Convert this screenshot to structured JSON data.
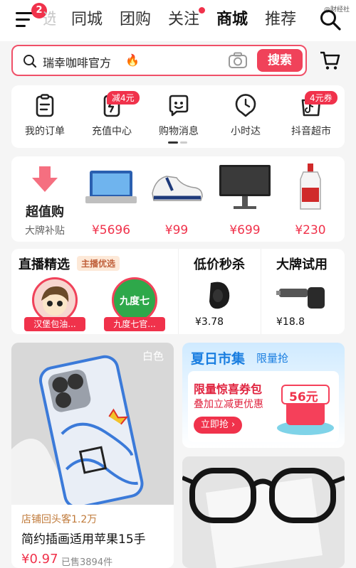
{
  "header": {
    "notification_count": "2",
    "tabs": [
      {
        "label": "选"
      },
      {
        "label": "同城"
      },
      {
        "label": "团购"
      },
      {
        "label": "关注"
      },
      {
        "label": "商城"
      },
      {
        "label": "推荐"
      }
    ],
    "active_tab": "商城",
    "watermark": "@财经社"
  },
  "search": {
    "query": "瑞幸咖啡官方",
    "button_label": "搜索"
  },
  "quick_links": [
    {
      "label": "我的订单",
      "icon": "order-icon"
    },
    {
      "label": "充值中心",
      "icon": "recharge-icon",
      "tag": "减4元"
    },
    {
      "label": "购物消息",
      "icon": "message-icon"
    },
    {
      "label": "小时达",
      "icon": "clock-icon"
    },
    {
      "label": "抖音超市",
      "icon": "supermarket-icon",
      "tag": "4元券"
    }
  ],
  "deals": {
    "title": "超值购",
    "subtitle": "大牌补贴",
    "products": [
      {
        "price": "¥5696",
        "icon": "tv-icon"
      },
      {
        "price": "¥99",
        "icon": "sneaker-icon"
      },
      {
        "price": "¥699",
        "icon": "monitor-icon"
      },
      {
        "price": "¥230",
        "icon": "liquor-icon"
      }
    ]
  },
  "live": {
    "title": "直播精选",
    "tag": "主播优选",
    "hosts": [
      {
        "name": "汉堡包油..."
      },
      {
        "name": "九度七官..."
      }
    ],
    "host_logo_text": "九度七"
  },
  "flash_sale": {
    "title": "低价秒杀",
    "price": "¥3.78"
  },
  "brand_trial": {
    "title": "大牌试用",
    "price": "¥18.8"
  },
  "feed": {
    "item1": {
      "tag": "白色",
      "shop": "店铺回头客1.2万",
      "title": "简约插画适用苹果15手",
      "price": "¥0.97",
      "sold": "已售3894件"
    },
    "promo": {
      "title": "夏日市集",
      "subtitle": "限量抢",
      "coupon_title": "限量惊喜券包",
      "coupon_desc": "叠加立减更优惠",
      "button": "立即抢",
      "coupon_value": "56元"
    }
  },
  "colors": {
    "accent": "#f0324b",
    "promo_blue": "#1a7ee0"
  }
}
